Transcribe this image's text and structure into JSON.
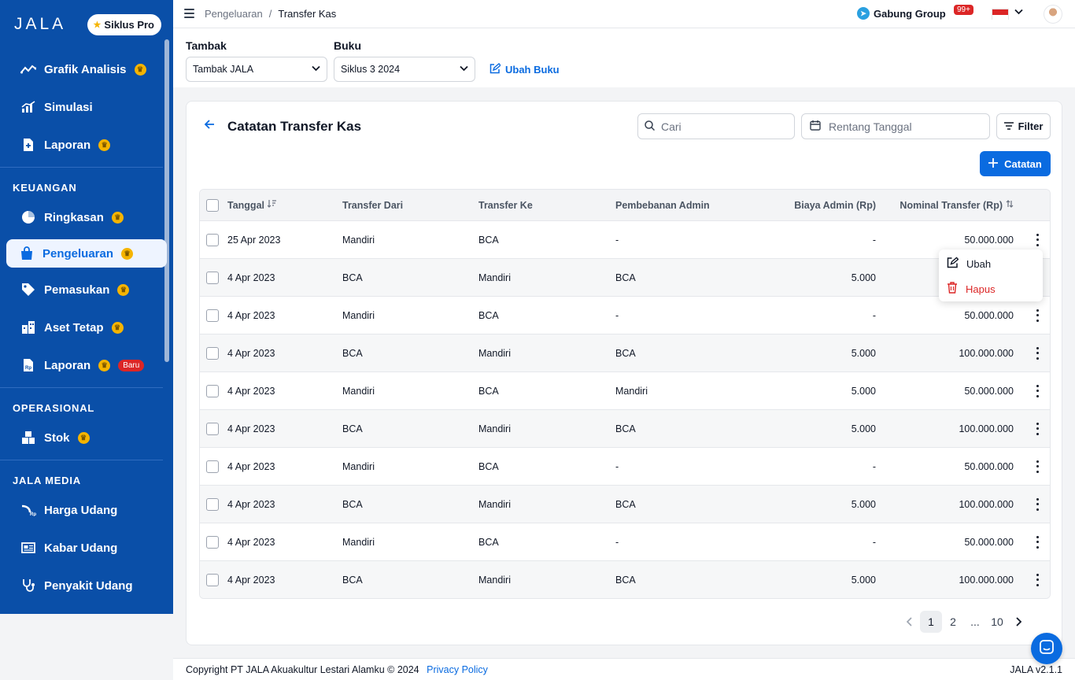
{
  "sidebar": {
    "logo": "JALA",
    "plan_badge": "Siklus Pro",
    "items_top": [
      {
        "label": "Grafik Analisis",
        "icon": "trend-icon",
        "pro": true
      },
      {
        "label": "Simulasi",
        "icon": "chart-icon",
        "pro": false
      },
      {
        "label": "Laporan",
        "icon": "report-icon",
        "pro": true
      }
    ],
    "section_keuangan": "KEUANGAN",
    "items_keuangan": [
      {
        "label": "Ringkasan",
        "icon": "pie-icon",
        "pro": true
      },
      {
        "label": "Pengeluaran",
        "icon": "bag-icon",
        "pro": true,
        "active": true
      },
      {
        "label": "Pemasukan",
        "icon": "tag-icon",
        "pro": true
      },
      {
        "label": "Aset Tetap",
        "icon": "building-icon",
        "pro": true
      },
      {
        "label": "Laporan",
        "icon": "rp-doc-icon",
        "pro": true,
        "badge": "Baru"
      }
    ],
    "section_operasional": "OPERASIONAL",
    "items_operasional": [
      {
        "label": "Stok",
        "icon": "boxes-icon",
        "pro": true
      }
    ],
    "section_media": "JALA MEDIA",
    "items_media": [
      {
        "label": "Harga Udang",
        "icon": "shrimp-price-icon"
      },
      {
        "label": "Kabar Udang",
        "icon": "news-icon"
      },
      {
        "label": "Penyakit Udang",
        "icon": "stethoscope-icon"
      }
    ]
  },
  "topbar": {
    "breadcrumb_parent": "Pengeluaran",
    "breadcrumb_sep": "/",
    "breadcrumb_current": "Transfer Kas",
    "group_link": "Gabung Group",
    "notif_count": "99+"
  },
  "filters": {
    "tambak_label": "Tambak",
    "tambak_value": "Tambak JALA",
    "buku_label": "Buku",
    "buku_value": "Siklus 3 2024",
    "ubah_buku": "Ubah Buku"
  },
  "card": {
    "title": "Catatan Transfer Kas",
    "search_placeholder": "Cari",
    "date_placeholder": "Rentang Tanggal",
    "filter_label": "Filter",
    "add_label": "Catatan"
  },
  "table": {
    "headers": {
      "date": "Tanggal",
      "from": "Transfer Dari",
      "to": "Transfer Ke",
      "load": "Pembebanan Admin",
      "admin": "Biaya Admin (Rp)",
      "nominal": "Nominal Transfer (Rp)"
    },
    "rows": [
      {
        "date": "25 Apr 2023",
        "from": "Mandiri",
        "to": "BCA",
        "load": "-",
        "admin": "-",
        "nominal": "50.000.000"
      },
      {
        "date": "4 Apr 2023",
        "from": "BCA",
        "to": "Mandiri",
        "load": "BCA",
        "admin": "5.000",
        "nominal": ""
      },
      {
        "date": "4 Apr 2023",
        "from": "Mandiri",
        "to": "BCA",
        "load": "-",
        "admin": "-",
        "nominal": "50.000.000"
      },
      {
        "date": "4 Apr 2023",
        "from": "BCA",
        "to": "Mandiri",
        "load": "BCA",
        "admin": "5.000",
        "nominal": "100.000.000"
      },
      {
        "date": "4 Apr 2023",
        "from": "Mandiri",
        "to": "BCA",
        "load": "Mandiri",
        "admin": "5.000",
        "nominal": "50.000.000"
      },
      {
        "date": "4 Apr 2023",
        "from": "BCA",
        "to": "Mandiri",
        "load": "BCA",
        "admin": "5.000",
        "nominal": "100.000.000"
      },
      {
        "date": "4 Apr 2023",
        "from": "Mandiri",
        "to": "BCA",
        "load": "-",
        "admin": "-",
        "nominal": "50.000.000"
      },
      {
        "date": "4 Apr 2023",
        "from": "BCA",
        "to": "Mandiri",
        "load": "BCA",
        "admin": "5.000",
        "nominal": "100.000.000"
      },
      {
        "date": "4 Apr 2023",
        "from": "Mandiri",
        "to": "BCA",
        "load": "-",
        "admin": "-",
        "nominal": "50.000.000"
      },
      {
        "date": "4 Apr 2023",
        "from": "BCA",
        "to": "Mandiri",
        "load": "BCA",
        "admin": "5.000",
        "nominal": "100.000.000"
      }
    ]
  },
  "row_menu": {
    "edit": "Ubah",
    "delete": "Hapus"
  },
  "pagination": {
    "pages": [
      "1",
      "2",
      "...",
      "10"
    ],
    "current": "1"
  },
  "footer": {
    "copyright": "Copyright PT JALA Akuakultur Lestari Alamku © 2024",
    "privacy": "Privacy Policy",
    "version": "JALA v2.1.1"
  },
  "colors": {
    "sidebar_bg": "#0a4fa8",
    "accent": "#0a6be0",
    "danger": "#dc2626",
    "pro_star": "#f5b400"
  }
}
